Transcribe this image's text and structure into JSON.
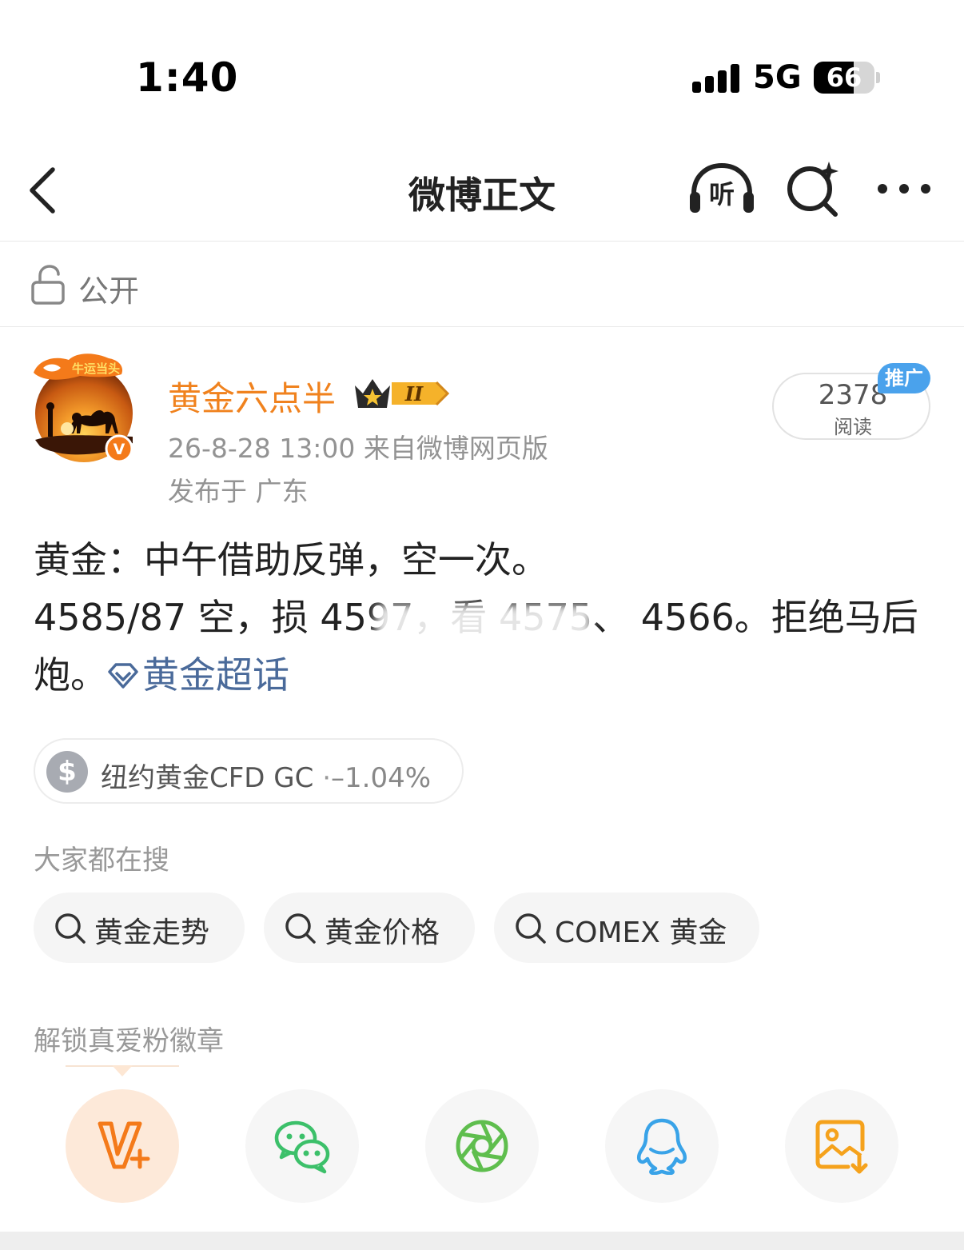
{
  "status_bar": {
    "time": "1:40",
    "network": "5G",
    "battery_level": "66",
    "battery_fraction": 0.66
  },
  "nav": {
    "title": "微博正文",
    "listen_label": "听"
  },
  "visibility": {
    "label": "公开"
  },
  "post": {
    "author": "黄金六点半",
    "badge_level": "II",
    "meta": "26-8-28 13:00  来自微博网页版",
    "location": "发布于 广东",
    "read_count": "2378",
    "read_label": "阅读",
    "promo_tag": "推广",
    "line1": "黄金：中午借助反弹，空一次。",
    "line2": "4585/87 空，损 4597，看 4575、 4566。拒绝马后炮。",
    "topic": "黄金超话"
  },
  "stock": {
    "name": "纽约黄金CFD GC",
    "separator": "·",
    "change": "–1.04%"
  },
  "search": {
    "heading": "大家都在搜",
    "chips": [
      "黄金走势",
      "黄金价格",
      "COMEX 黄金"
    ]
  },
  "fan_badge": {
    "heading": "解锁真爱粉徽章"
  },
  "share": {
    "icons": [
      "vip-plus-icon",
      "wechat-icon",
      "moments-icon",
      "qq-icon",
      "save-image-icon"
    ]
  },
  "colors": {
    "author": "#f0821e",
    "topic": "#4a6a9a",
    "promo": "#4aa2ec",
    "wechat": "#3cc06a",
    "qq": "#39a3e8",
    "save_image": "#f5a21c"
  }
}
